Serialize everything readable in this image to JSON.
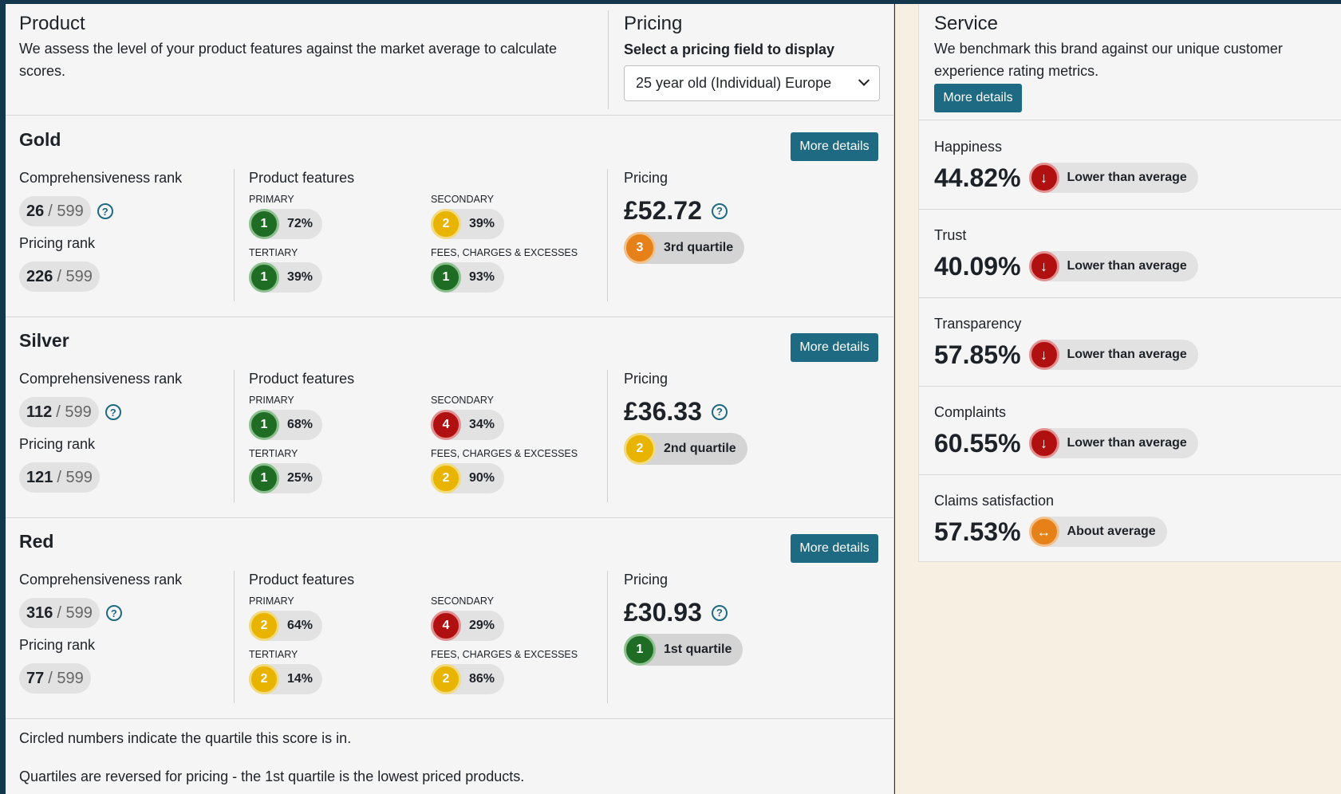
{
  "product": {
    "title": "Product",
    "description": "We assess the level of your product features against the market average to calculate scores."
  },
  "pricing_header": {
    "title": "Pricing",
    "select_label": "Select a pricing field to display",
    "selected_option": "25 year old (Individual) Europe"
  },
  "tiers": [
    {
      "name": "Gold",
      "button": "More details",
      "comp_rank_label": "Comprehensiveness rank",
      "comp_rank": "26",
      "comp_rank_total": "/ 599",
      "pricing_rank_label": "Pricing rank",
      "pricing_rank": "226",
      "pricing_rank_total": "/ 599",
      "features_label": "Product features",
      "features": [
        {
          "label": "PRIMARY",
          "quartile": "1",
          "pct": "72%",
          "color": "green"
        },
        {
          "label": "SECONDARY",
          "quartile": "2",
          "pct": "39%",
          "color": "yellow"
        },
        {
          "label": "TERTIARY",
          "quartile": "1",
          "pct": "39%",
          "color": "green"
        },
        {
          "label": "FEES, CHARGES & EXCESSES",
          "quartile": "1",
          "pct": "93%",
          "color": "green"
        }
      ],
      "pricing_label": "Pricing",
      "price": "£52.72",
      "price_quartile": "3",
      "price_quartile_text": "3rd quartile",
      "price_quartile_color": "orange"
    },
    {
      "name": "Silver",
      "button": "More details",
      "comp_rank_label": "Comprehensiveness rank",
      "comp_rank": "112",
      "comp_rank_total": "/ 599",
      "pricing_rank_label": "Pricing rank",
      "pricing_rank": "121",
      "pricing_rank_total": "/ 599",
      "features_label": "Product features",
      "features": [
        {
          "label": "PRIMARY",
          "quartile": "1",
          "pct": "68%",
          "color": "green"
        },
        {
          "label": "SECONDARY",
          "quartile": "4",
          "pct": "34%",
          "color": "red"
        },
        {
          "label": "TERTIARY",
          "quartile": "1",
          "pct": "25%",
          "color": "green"
        },
        {
          "label": "FEES, CHARGES & EXCESSES",
          "quartile": "2",
          "pct": "90%",
          "color": "yellow"
        }
      ],
      "pricing_label": "Pricing",
      "price": "£36.33",
      "price_quartile": "2",
      "price_quartile_text": "2nd quartile",
      "price_quartile_color": "yellow"
    },
    {
      "name": "Red",
      "button": "More details",
      "comp_rank_label": "Comprehensiveness rank",
      "comp_rank": "316",
      "comp_rank_total": "/ 599",
      "pricing_rank_label": "Pricing rank",
      "pricing_rank": "77",
      "pricing_rank_total": "/ 599",
      "features_label": "Product features",
      "features": [
        {
          "label": "PRIMARY",
          "quartile": "2",
          "pct": "64%",
          "color": "yellow"
        },
        {
          "label": "SECONDARY",
          "quartile": "4",
          "pct": "29%",
          "color": "red"
        },
        {
          "label": "TERTIARY",
          "quartile": "2",
          "pct": "14%",
          "color": "yellow"
        },
        {
          "label": "FEES, CHARGES & EXCESSES",
          "quartile": "2",
          "pct": "86%",
          "color": "yellow"
        }
      ],
      "pricing_label": "Pricing",
      "price": "£30.93",
      "price_quartile": "1",
      "price_quartile_text": "1st quartile",
      "price_quartile_color": "green"
    }
  ],
  "notes": [
    "Circled numbers indicate the quartile this score is in.",
    "Quartiles are reversed for pricing - the 1st quartile is the lowest priced products."
  ],
  "service": {
    "title": "Service",
    "description": "We benchmark this brand against our unique customer experience rating metrics.",
    "button": "More details",
    "metrics": [
      {
        "label": "Happiness",
        "value": "44.82%",
        "status": "Lower than average",
        "icon": "arrow-down-icon",
        "color": "red"
      },
      {
        "label": "Trust",
        "value": "40.09%",
        "status": "Lower than average",
        "icon": "arrow-down-icon",
        "color": "red"
      },
      {
        "label": "Transparency",
        "value": "57.85%",
        "status": "Lower than average",
        "icon": "arrow-down-icon",
        "color": "red"
      },
      {
        "label": "Complaints",
        "value": "60.55%",
        "status": "Lower than average",
        "icon": "arrow-down-icon",
        "color": "red"
      },
      {
        "label": "Claims satisfaction",
        "value": "57.53%",
        "status": "About average",
        "icon": "arrows-horizontal-icon",
        "color": "orange"
      }
    ]
  },
  "colors": {
    "button": "#1e6a82",
    "green": "#1f6d24",
    "yellow": "#e8b400",
    "red": "#b01010",
    "orange": "#e6811a",
    "frame": "#13384e"
  }
}
